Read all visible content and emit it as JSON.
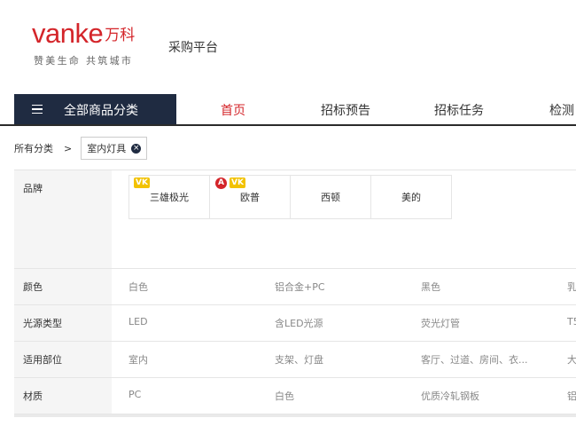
{
  "header": {
    "logo_text": "vanke",
    "logo_cn": "万科",
    "logo_slogan": "赞美生命 共筑城市",
    "platform": "采购平台"
  },
  "nav": {
    "category_label": "全部商品分类",
    "items": [
      "首页",
      "招标预告",
      "招标任务",
      "检测"
    ]
  },
  "breadcrumb": {
    "root": "所有分类",
    "arrow": ">",
    "tag": "室内灯具",
    "tag_close": "×"
  },
  "filters": {
    "brand": {
      "label": "品牌",
      "options": [
        {
          "name": "三雄极光",
          "badges": [
            "VK"
          ]
        },
        {
          "name": "欧普",
          "badges": [
            "A",
            "VK"
          ]
        },
        {
          "name": "西顿",
          "badges": []
        },
        {
          "name": "美的",
          "badges": []
        }
      ]
    },
    "color": {
      "label": "颜色",
      "values": [
        "白色",
        "铝合金+PC",
        "黑色",
        "乳"
      ]
    },
    "light_source": {
      "label": "光源类型",
      "values": [
        "LED",
        "含LED光源",
        "荧光灯管",
        "T5"
      ]
    },
    "location": {
      "label": "适用部位",
      "values": [
        "室内",
        "支架、灯盘",
        "客厅、过道、房间、衣...",
        "大"
      ]
    },
    "material": {
      "label": "材质",
      "values": [
        "PC",
        "白色",
        "优质冷轧钢板",
        "铝"
      ]
    }
  },
  "colors": {
    "brand_red": "#d4252a",
    "nav_dark": "#1f2b41",
    "badge_yellow": "#f2c200"
  }
}
